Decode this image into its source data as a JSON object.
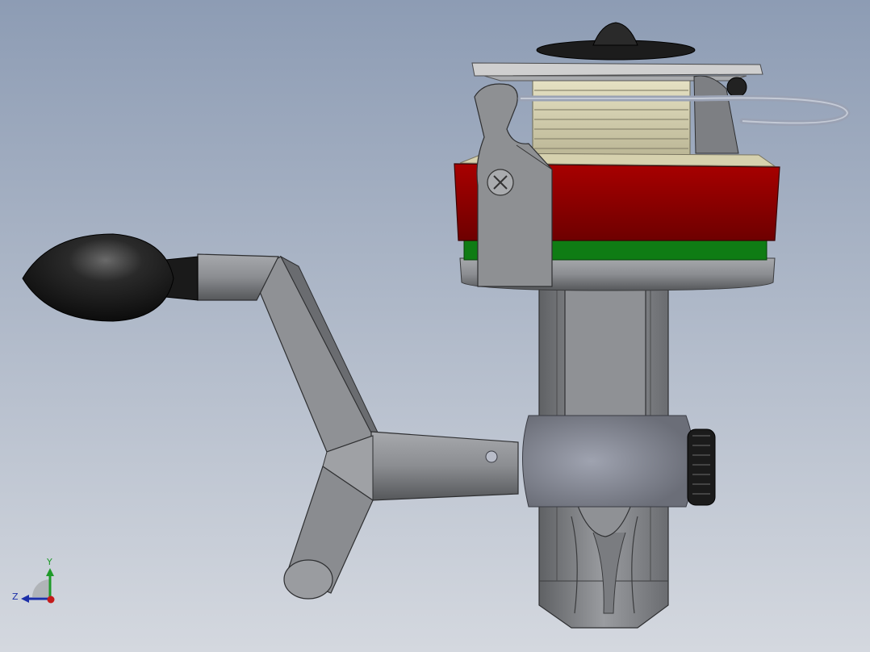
{
  "triad": {
    "y_label": "Y",
    "z_label": "Z"
  },
  "colors": {
    "background_top": "#8e9db5",
    "background_bottom": "#d2d6de",
    "housing_grey": "#8a8c90",
    "spool_red": "#8c0000",
    "spool_green": "#0e7a12",
    "spool_thread": "#d8d3b0",
    "knob_black": "#1a1a1a",
    "axis_y": "#1f9a2a",
    "axis_z": "#1c2fa8",
    "axis_x": "#c41a1a"
  },
  "model": {
    "components": [
      "handle-knob",
      "crank-arm",
      "crank-hub",
      "reel-body",
      "spool",
      "bail-arm",
      "line-roller",
      "drag-knob"
    ]
  }
}
